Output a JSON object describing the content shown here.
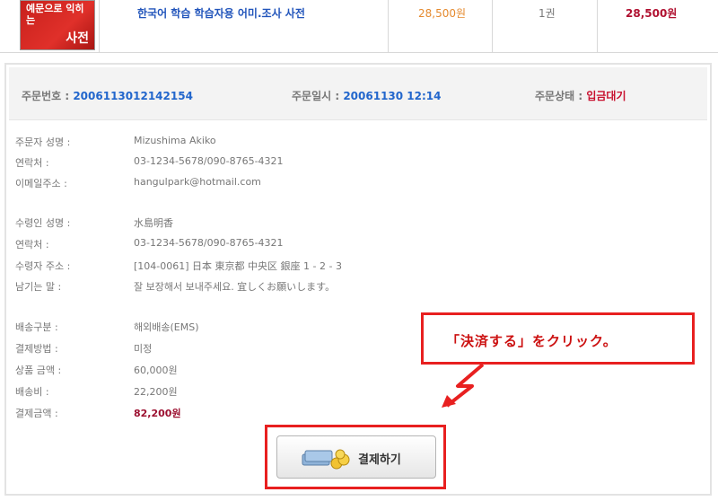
{
  "product": {
    "thumb_line1": "예문으로 익히는",
    "thumb_line2": "사전",
    "name": "한국어 학습 학습자용 어미.조사 사전",
    "unit_price": "28,500원",
    "quantity": "1권",
    "line_total": "28,500원"
  },
  "summary": {
    "order_no_label": "주문번호 :",
    "order_no": "20061130121421​54",
    "order_date_label": "주문일시 :",
    "order_date": "20061130 12:14",
    "status_label": "주문상태 :",
    "status": "입금대기"
  },
  "orderer": {
    "name_label": "주문자 성명 :",
    "name": "Mizushima Akiko",
    "phone_label": "연락처 :",
    "phone": "03-1234-5678/090-8765-4321",
    "email_label": "이메일주소 :",
    "email": "hangulpark@hotmail.com"
  },
  "recipient": {
    "name_label": "수령인 성명 :",
    "name": "水島明香",
    "phone_label": "연락처 :",
    "phone": "03-1234-5678/090-8765-4321",
    "address_label": "수령자 주소 :",
    "address": "[104-0061] 日本 東京都 中央区 銀座 1 - 2 - 3",
    "message_label": "남기는 말 :",
    "message": "잘 보장해서 보내주세요. 宜しくお願いします。"
  },
  "payment": {
    "shipping_type_label": "배송구분 :",
    "shipping_type": "해외배송(EMS)",
    "method_label": "결제방법 :",
    "method": "미정",
    "goods_amount_label": "상품 금액 :",
    "goods_amount": "60,000원",
    "shipping_fee_label": "배송비 :",
    "shipping_fee": "22,200원",
    "total_label": "결제금액 :",
    "total": "82,200원"
  },
  "callout_text": "「決済する」をクリック。",
  "pay_button_label": "결제하기",
  "colors": {
    "accent_red": "#e82020",
    "link_blue": "#2266cc",
    "amount_red": "#b01030"
  }
}
